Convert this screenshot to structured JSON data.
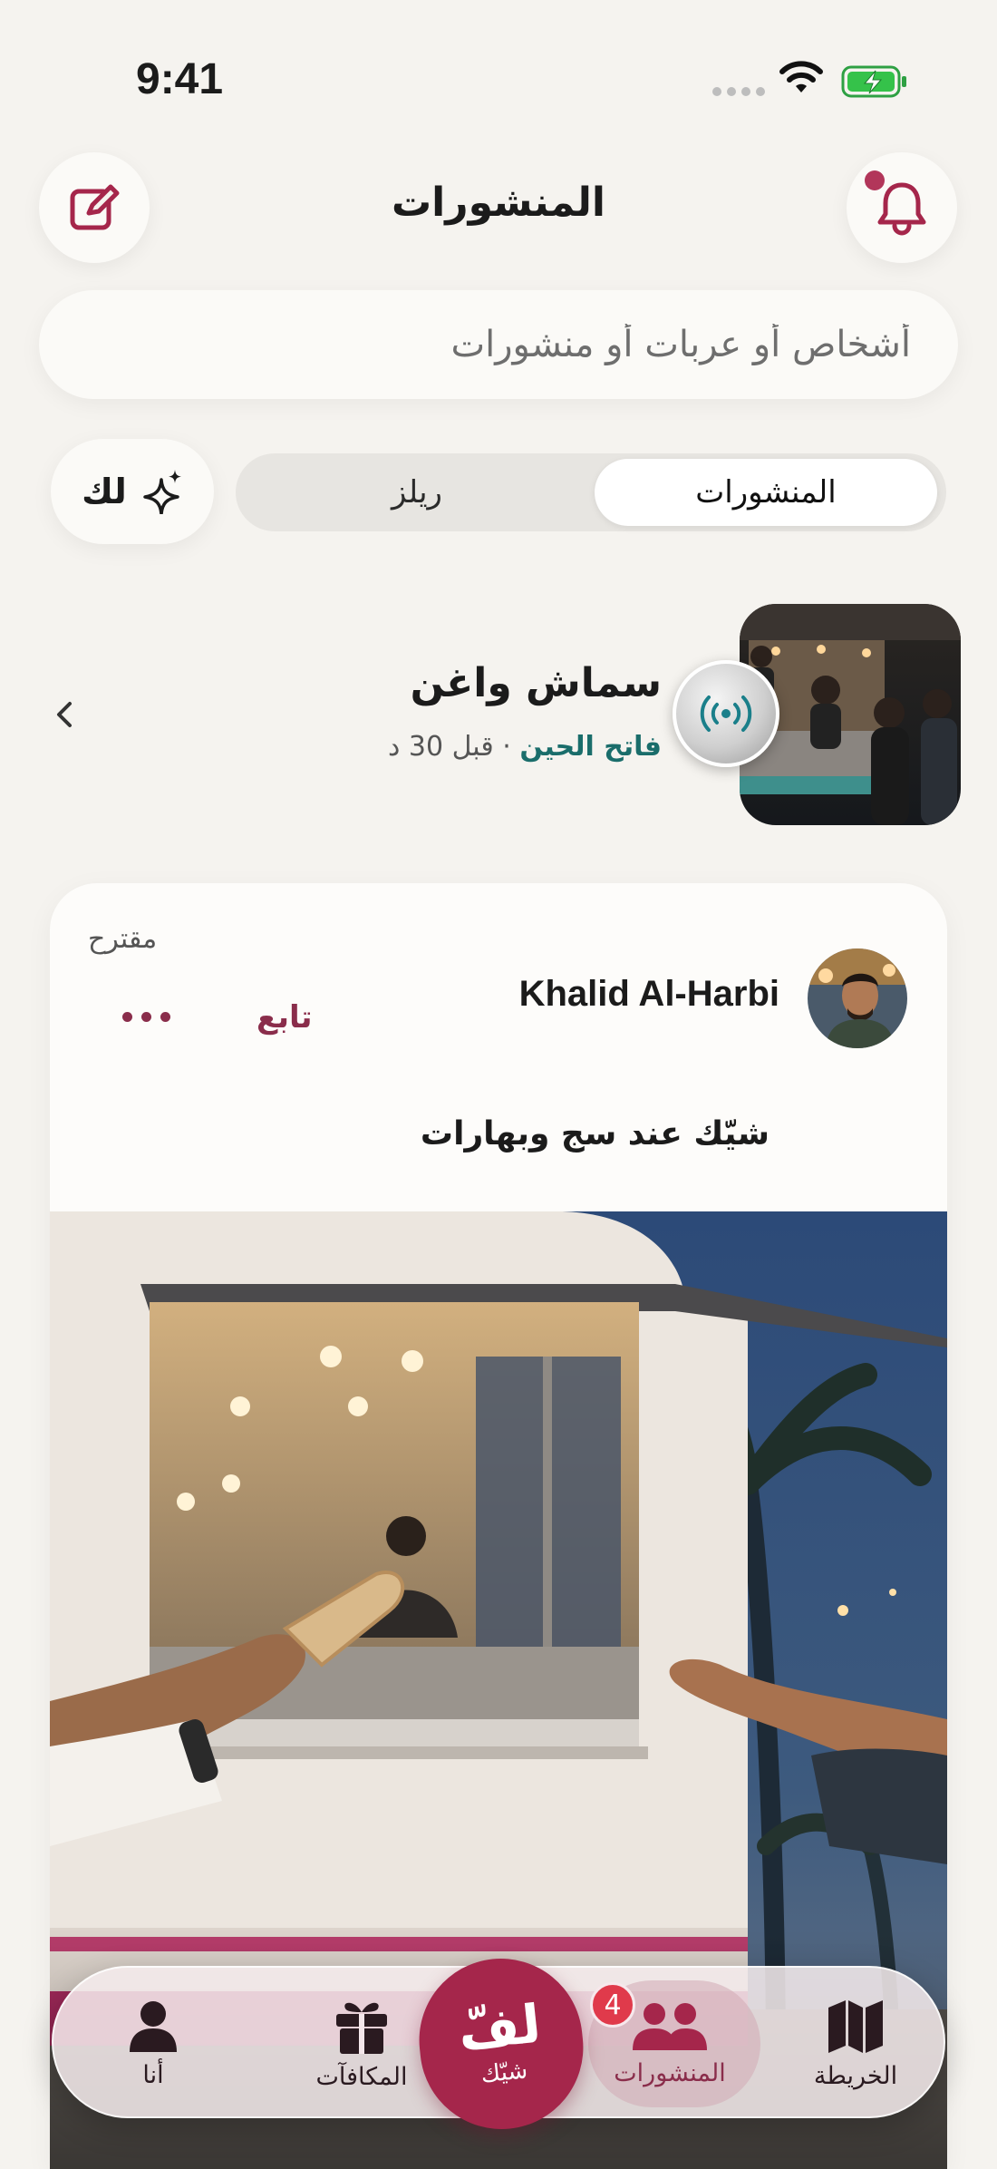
{
  "status_bar": {
    "time": "9:41"
  },
  "header": {
    "title": "المنشورات"
  },
  "search": {
    "placeholder": "أشخاص أو عربات أو منشورات"
  },
  "feed_switch": {
    "for_you_label": "لك",
    "tabs": [
      {
        "label": "ريلز"
      },
      {
        "label": "المنشورات"
      }
    ],
    "selected": "المنشورات"
  },
  "place": {
    "name": "سماش واغن",
    "status": "فاتح الحين",
    "time_ago": "قبل 30 د",
    "separator": "·"
  },
  "post": {
    "suggested_label": "مقترح",
    "author": "Khalid Al-Harbi",
    "follow_label": "تابع",
    "caption": "شيّك عند سج وبهارات"
  },
  "tabbar": {
    "map_label": "الخريطة",
    "posts_label": "المنشورات",
    "posts_badge": "4",
    "center_logo": "لفّ",
    "center_label": "شيّك",
    "rewards_label": "المكافآت",
    "me_label": "أنا"
  },
  "colors": {
    "accent": "#a5264b",
    "accent_text": "#8a2d4b",
    "open_status": "#1a6d6b",
    "badge": "#e03a4b",
    "background": "#f5f3ef"
  }
}
